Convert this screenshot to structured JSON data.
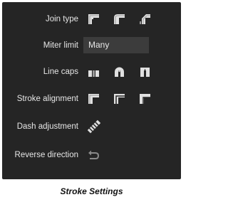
{
  "panel": {
    "join_type": {
      "label": "Join type",
      "icons": [
        "miter-join-icon",
        "round-join-icon",
        "bevel-join-icon"
      ]
    },
    "miter_limit": {
      "label": "Miter limit",
      "value": "Many"
    },
    "line_caps": {
      "label": "Line caps",
      "icons": [
        "butt-cap-icon",
        "round-cap-icon",
        "square-cap-icon"
      ]
    },
    "stroke_alignment": {
      "label": "Stroke alignment",
      "icons": [
        "align-inside-icon",
        "align-center-icon",
        "align-outside-icon"
      ]
    },
    "dash_adjustment": {
      "label": "Dash adjustment",
      "icon": "dash-adjust-icon"
    },
    "reverse_direction": {
      "label": "Reverse direction",
      "icon": "reverse-arrow-icon"
    }
  },
  "caption": "Stroke Settings",
  "colors": {
    "panel_bg": "#252525",
    "label_text": "#e6e6e6",
    "field_bg": "#3c3c3c",
    "icon_light": "#e0e0e0",
    "icon_dim": "#9a9a9a"
  }
}
